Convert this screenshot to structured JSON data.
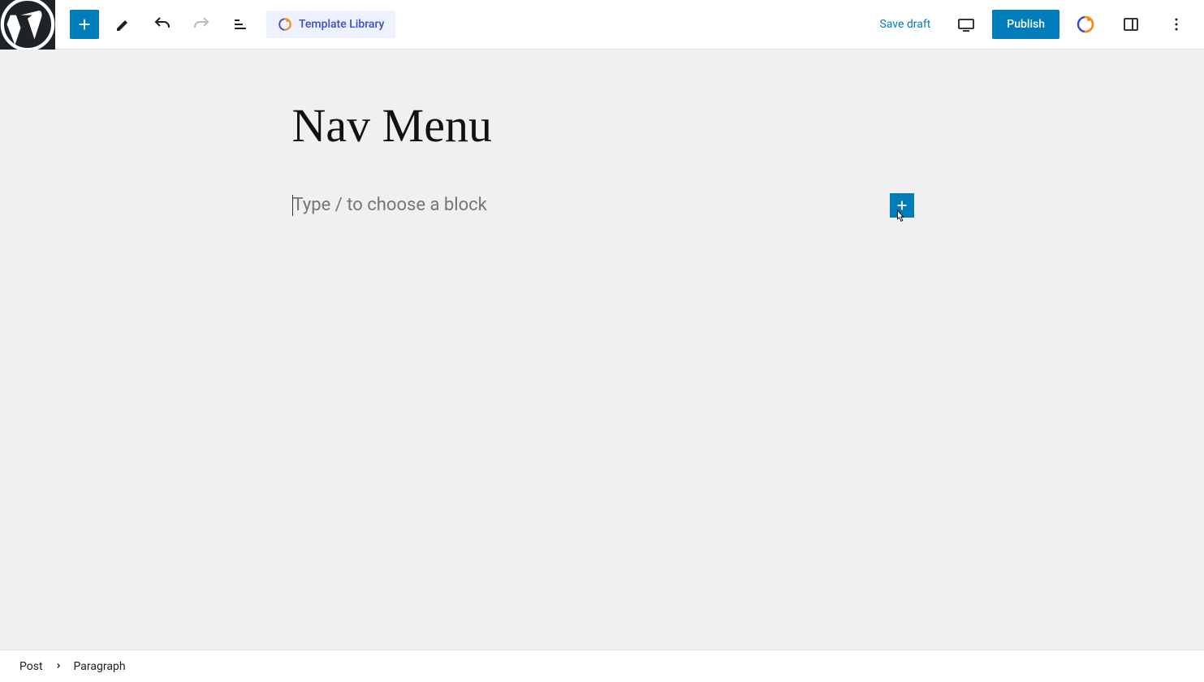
{
  "topbar": {
    "template_library_label": "Template Library"
  },
  "actions": {
    "save_draft": "Save draft",
    "publish": "Publish"
  },
  "editor": {
    "title": "Nav Menu",
    "block_placeholder": "Type / to choose a block"
  },
  "breadcrumb": {
    "root": "Post",
    "current": "Paragraph"
  },
  "colors": {
    "accent": "#007cba",
    "template_bg": "#eef1ff",
    "template_fg": "#3b4cca"
  }
}
